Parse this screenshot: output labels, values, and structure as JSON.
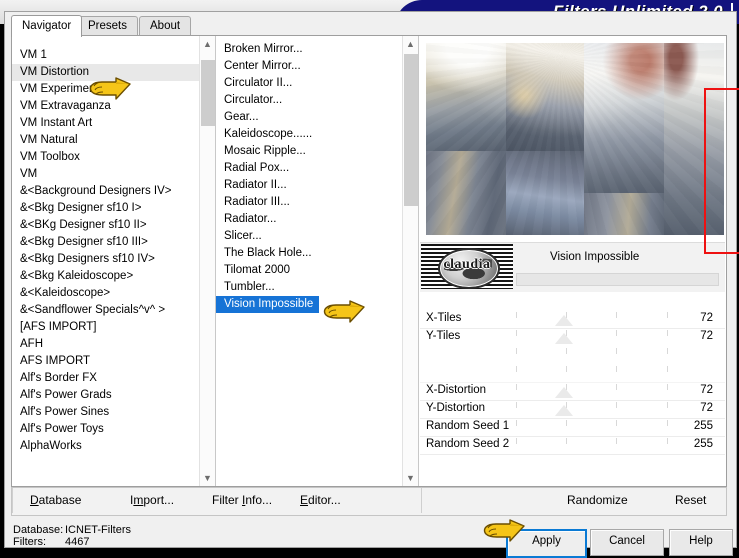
{
  "window": {
    "title": "Filters Unlimited 2.0"
  },
  "tabs": [
    {
      "label": "Navigator",
      "active": true
    },
    {
      "label": "Presets",
      "active": false
    },
    {
      "label": "About",
      "active": false
    }
  ],
  "categories": {
    "selected": "VM Distortion",
    "items": [
      "VM 1",
      "VM Distortion",
      "VM Experimental",
      "VM Extravaganza",
      "VM Instant Art",
      "VM Natural",
      "VM Toolbox",
      "VM",
      "&<Background Designers IV>",
      "&<Bkg Designer sf10 I>",
      "&<BKg Designer sf10 II>",
      "&<Bkg Designer sf10 III>",
      "&<Bkg Designers sf10 IV>",
      "&<Bkg Kaleidoscope>",
      "&<Kaleidoscope>",
      "&<Sandflower Specials^v^ >",
      "[AFS IMPORT]",
      "AFH",
      "AFS IMPORT",
      "Alf's Border FX",
      "Alf's Power Grads",
      "Alf's Power Sines",
      "Alf's Power Toys",
      "AlphaWorks"
    ]
  },
  "filters": {
    "selected": "Vision Impossible",
    "items": [
      "Broken Mirror...",
      "Center Mirror...",
      "Circulator II...",
      "Circulator...",
      "Gear...",
      "Kaleidoscope......",
      "Mosaic Ripple...",
      "Radial Pox...",
      "Radiator II...",
      "Radiator III...",
      "Radiator...",
      "Slicer...",
      "The Black Hole...",
      "Tilomat 2000",
      "Tumbler...",
      "Vision Impossible"
    ]
  },
  "filter_header": {
    "logo_word": "claudia",
    "name": "Vision Impossible"
  },
  "parameters": [
    {
      "label": "X-Tiles",
      "value": "72",
      "thumb_pct": 32
    },
    {
      "label": "Y-Tiles",
      "value": "72",
      "thumb_pct": 32
    },
    {
      "label": "",
      "value": "",
      "thumb_pct": -1
    },
    {
      "label": "",
      "value": "",
      "thumb_pct": -1
    },
    {
      "label": "X-Distortion",
      "value": "72",
      "thumb_pct": 32
    },
    {
      "label": "Y-Distortion",
      "value": "72",
      "thumb_pct": 32
    },
    {
      "label": "Random Seed 1",
      "value": "255",
      "thumb_pct": -1
    },
    {
      "label": "Random Seed 2",
      "value": "255",
      "thumb_pct": -1
    }
  ],
  "toolbar": {
    "database": "Database",
    "import": "Import...",
    "filter_info": "Filter Info...",
    "editor": "Editor...",
    "randomize": "Randomize",
    "reset": "Reset"
  },
  "status": {
    "database_label": "Database:",
    "database_value": "ICNET-Filters",
    "filters_label": "Filters:",
    "filters_value": "4467"
  },
  "dialog_buttons": {
    "apply": "Apply",
    "cancel": "Cancel",
    "help": "Help"
  },
  "colors": {
    "title_blue": "#13137e",
    "selection_blue": "#1673d6",
    "highlight_red": "#ee1111",
    "focus_blue": "#0a7ad4"
  }
}
